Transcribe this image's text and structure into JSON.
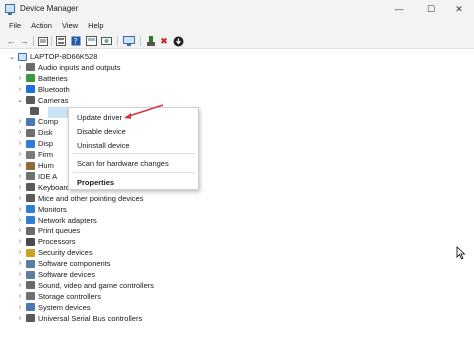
{
  "window": {
    "title": "Device Manager",
    "minimize": "—",
    "maximize": "☐",
    "close": "✕"
  },
  "menu": [
    "File",
    "Action",
    "View",
    "Help"
  ],
  "toolbar": {
    "back": "←",
    "forward": "→",
    "remove": "✖",
    "update": "⬇"
  },
  "tree": {
    "root": "LAPTOP-8D66K528",
    "items": [
      {
        "label": "Audio inputs and outputs",
        "color": "#6b6b6b"
      },
      {
        "label": "Batteries",
        "color": "#3a9a3a"
      },
      {
        "label": "Bluetooth",
        "color": "#1e6fd9"
      },
      {
        "label": "Cameras",
        "color": "#5a5a5a"
      },
      {
        "label": "",
        "color": "#5a5a5a"
      },
      {
        "label": "Comp",
        "color": "#4a78b0"
      },
      {
        "label": "Disk",
        "color": "#707070"
      },
      {
        "label": "Disp",
        "color": "#2f7fd4"
      },
      {
        "label": "Firm",
        "color": "#7a7a7a"
      },
      {
        "label": "Hum",
        "color": "#8a6d3b"
      },
      {
        "label": "IDE A",
        "color": "#707070"
      },
      {
        "label": "Keyboards",
        "color": "#5a5a5a"
      },
      {
        "label": "Mice and other pointing devices",
        "color": "#5a5a5a"
      },
      {
        "label": "Monitors",
        "color": "#2f7fd4"
      },
      {
        "label": "Network adapters",
        "color": "#2f7fd4"
      },
      {
        "label": "Print queues",
        "color": "#6b6b6b"
      },
      {
        "label": "Processors",
        "color": "#4a4a4a"
      },
      {
        "label": "Security devices",
        "color": "#c9a227"
      },
      {
        "label": "Software components",
        "color": "#5a7fa0"
      },
      {
        "label": "Software devices",
        "color": "#5a7fa0"
      },
      {
        "label": "Sound, video and game controllers",
        "color": "#6b6b6b"
      },
      {
        "label": "Storage controllers",
        "color": "#707070"
      },
      {
        "label": "System devices",
        "color": "#4a78b0"
      },
      {
        "label": "Universal Serial Bus controllers",
        "color": "#5a5a5a"
      }
    ]
  },
  "context_menu": {
    "update_driver": "Update driver",
    "disable_device": "Disable device",
    "uninstall_device": "Uninstall device",
    "scan": "Scan for hardware changes",
    "properties": "Properties"
  },
  "colors": {
    "selection": "#cce4f7",
    "annotation_arrow": "#d9363e"
  }
}
